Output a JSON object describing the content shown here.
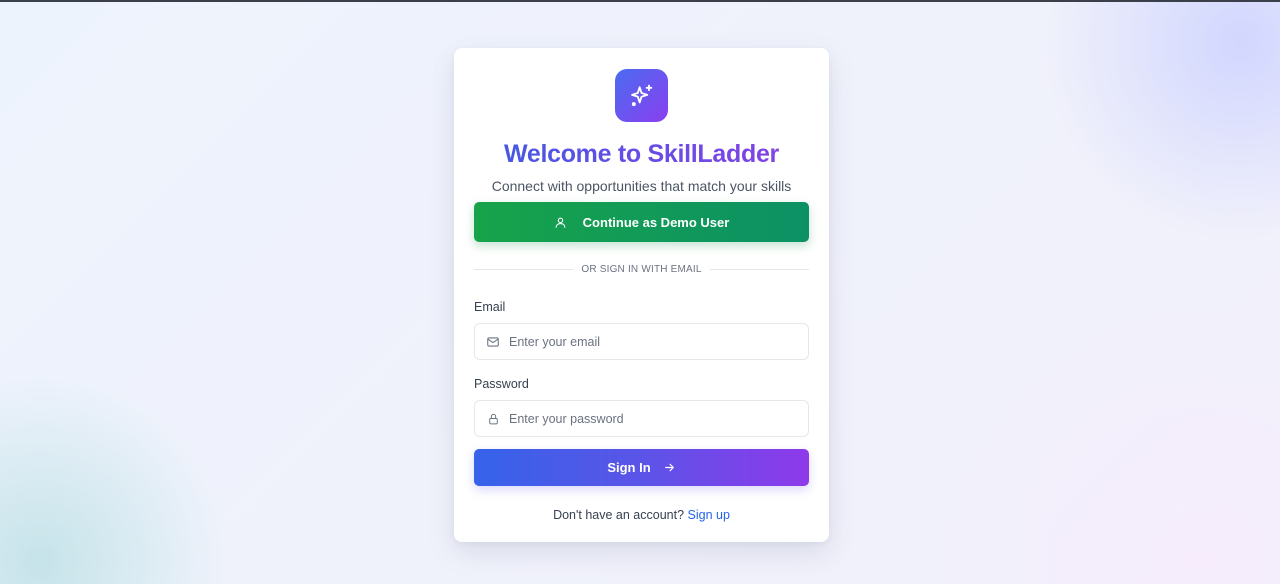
{
  "login": {
    "logo_icon": "sparkles-icon",
    "title": "Welcome to SkillLadder",
    "subtitle": "Connect with opportunities that match your skills",
    "demo_button": {
      "label": "Continue as Demo User",
      "icon": "user-icon"
    },
    "divider_text": "OR SIGN IN WITH EMAIL",
    "email": {
      "label": "Email",
      "placeholder": "Enter your email",
      "value": "",
      "icon": "mail-icon"
    },
    "password": {
      "label": "Password",
      "placeholder": "Enter your password",
      "value": "",
      "icon": "lock-icon"
    },
    "signin_button": {
      "label": "Sign In",
      "icon": "arrow-right-icon"
    },
    "footer": {
      "prompt": "Don't have an account?",
      "link": "Sign up"
    }
  },
  "colors": {
    "brand_gradient_start": "#4a6cf0",
    "brand_gradient_end": "#8a3ff0",
    "demo_green": "#17a34a",
    "link_blue": "#2563eb"
  }
}
